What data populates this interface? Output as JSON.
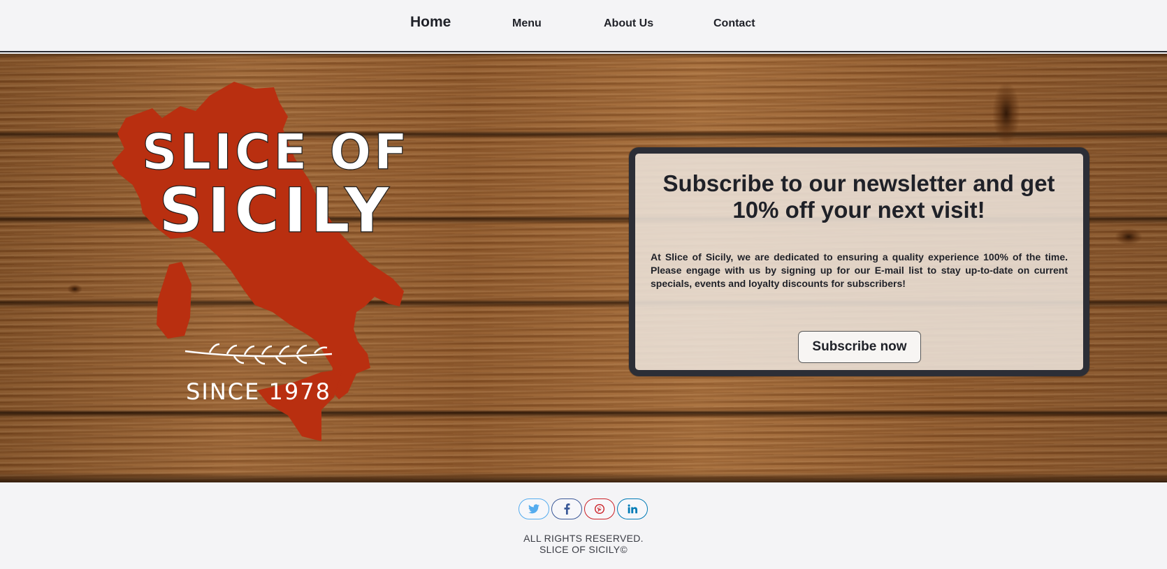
{
  "nav": {
    "items": [
      {
        "label": "Home"
      },
      {
        "label": "Menu"
      },
      {
        "label": "About Us"
      },
      {
        "label": "Contact"
      }
    ]
  },
  "hero": {
    "logo": {
      "top_text": "SLICE OF",
      "main_text": "SICILY",
      "since_text": "SINCE 1978",
      "shape_color": "#b92f10"
    }
  },
  "newsletter": {
    "title_line1": "Subscribe to our newsletter and get",
    "title_line2": "10% off your next visit!",
    "body": "At Slice of Sicily, we are dedicated to ensuring a quality experience 100% of the time. Please engage with us by signing up for our E-mail list to stay up-to-date on current specials, events and loyalty discounts for subscribers!",
    "button_label": "Subscribe now"
  },
  "footer": {
    "social": [
      {
        "icon": "twitter-icon",
        "color": "#55acee"
      },
      {
        "icon": "facebook-icon",
        "color": "#3b5998"
      },
      {
        "icon": "pinterest-icon",
        "color": "#cb2027"
      },
      {
        "icon": "linkedin-icon",
        "color": "#007bb6"
      }
    ],
    "rights": "ALL RIGHTS RESERVED.",
    "copyright": "SLICE OF SICILY©"
  }
}
